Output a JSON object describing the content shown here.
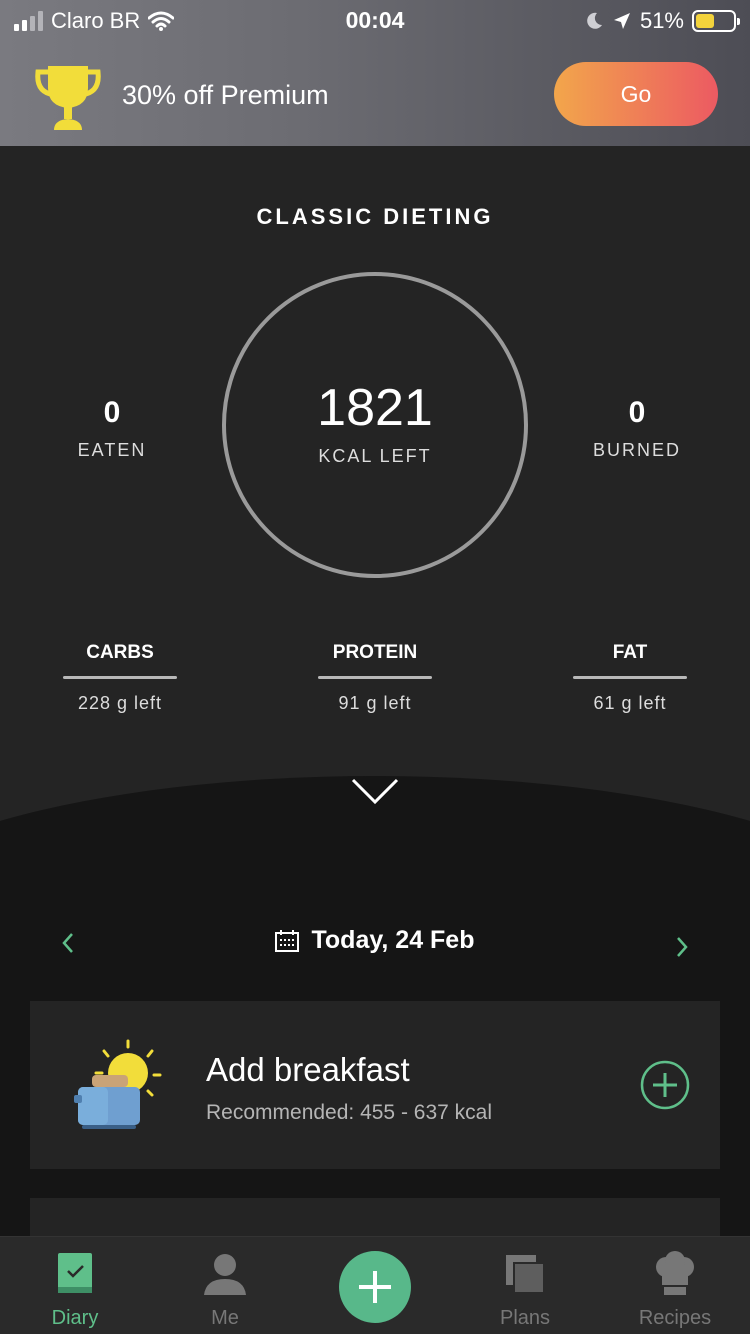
{
  "status_bar": {
    "carrier": "Claro BR",
    "time": "00:04",
    "battery_percent": "51%",
    "battery_level": 0.51
  },
  "promo": {
    "text": "30% off Premium",
    "button_label": "Go",
    "icon": "trophy-icon"
  },
  "summary": {
    "plan_title": "CLASSIC DIETING",
    "kcal_left_value": "1821",
    "kcal_left_label": "KCAL LEFT",
    "eaten_value": "0",
    "eaten_label": "EATEN",
    "burned_value": "0",
    "burned_label": "BURNED",
    "macros": [
      {
        "name": "CARBS",
        "left": "228 g left"
      },
      {
        "name": "PROTEIN",
        "left": "91 g left"
      },
      {
        "name": "FAT",
        "left": "61 g left"
      }
    ]
  },
  "date_nav": {
    "label": "Today, 24 Feb"
  },
  "meal": {
    "title": "Add breakfast",
    "subtitle": "Recommended: 455 - 637  kcal"
  },
  "tabs": [
    {
      "label": "Diary",
      "icon": "diary-icon"
    },
    {
      "label": "Me",
      "icon": "person-icon"
    },
    {
      "label": "",
      "icon": "plus-icon"
    },
    {
      "label": "Plans",
      "icon": "plans-icon"
    },
    {
      "label": "Recipes",
      "icon": "chef-hat-icon"
    }
  ],
  "colors": {
    "accent_green": "#5fbf8a",
    "go_gradient_start": "#f2a64b",
    "go_gradient_end": "#ec5a62",
    "panel": "#242424",
    "background": "#151515"
  }
}
